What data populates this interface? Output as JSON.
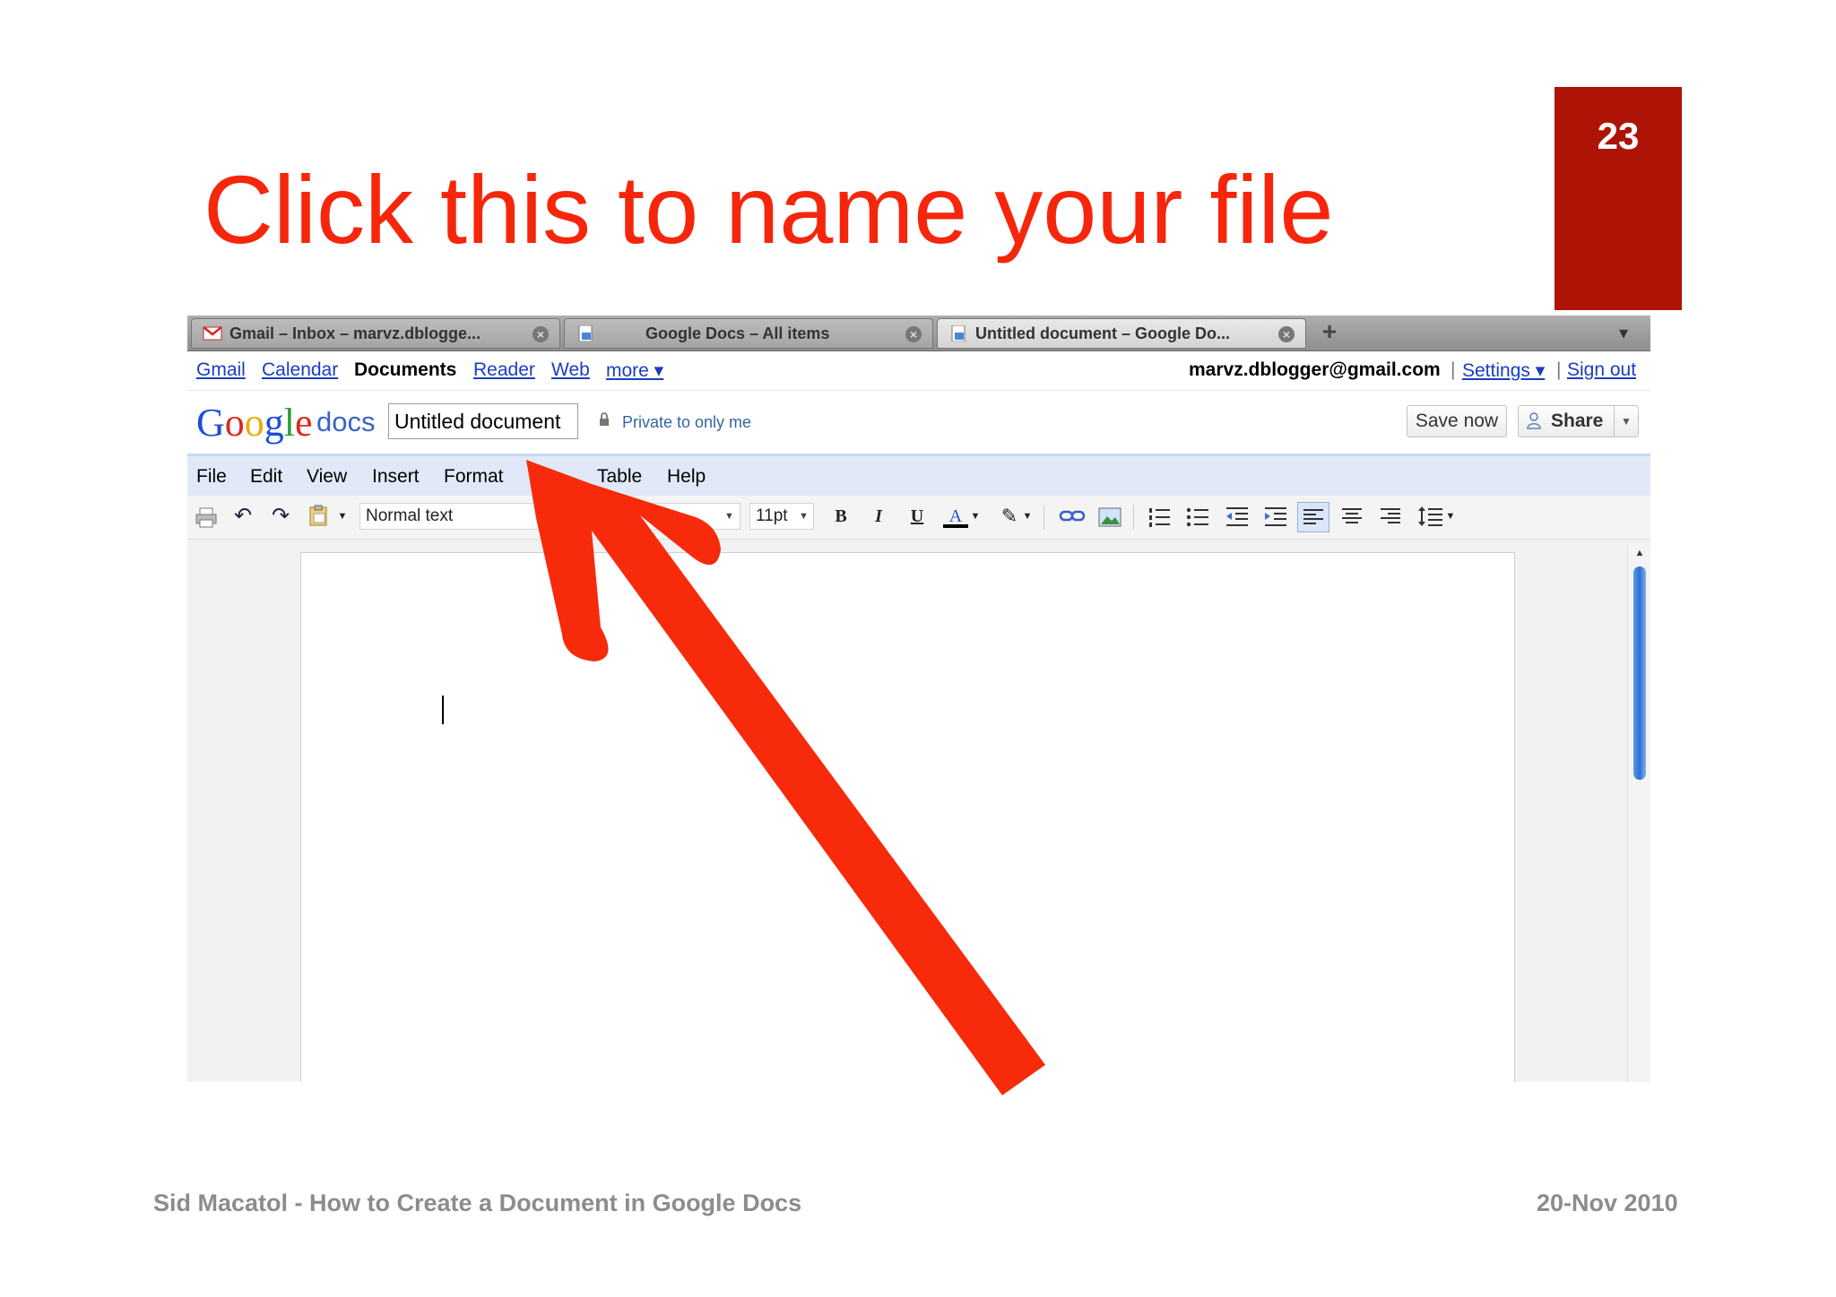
{
  "slide": {
    "number": "23",
    "title": "Click this to name your file",
    "footer_left": "Sid Macatol - How to Create a Document in Google Docs",
    "footer_right": "20-Nov 2010",
    "accent_color": "#f5260c",
    "number_box_color": "#ad1405"
  },
  "browser": {
    "tabs": [
      {
        "label": "Gmail – Inbox – marvz.dblogge...",
        "icon": "gmail-icon",
        "active": false
      },
      {
        "label": "Google Docs – All items",
        "icon": "docs-icon",
        "active": false
      },
      {
        "label": "Untitled document – Google Do...",
        "icon": "docs-icon",
        "active": true
      }
    ],
    "new_tab_label": "+"
  },
  "gbar": {
    "links": [
      "Gmail",
      "Calendar",
      "Documents",
      "Reader",
      "Web",
      "more ▾"
    ],
    "active": "Documents",
    "account_email": "marvz.dblogger@gmail.com",
    "settings_label": "Settings ▾",
    "signout_label": "Sign out",
    "separator": "|"
  },
  "doc": {
    "logo_text": "Google",
    "product_text": "docs",
    "title": "Untitled document",
    "privacy": "Private to only me",
    "save_label": "Save now",
    "share_label": "Share"
  },
  "menubar": {
    "items": [
      "File",
      "Edit",
      "View",
      "Insert",
      "Format",
      "Table",
      "Help"
    ]
  },
  "toolbar": {
    "style_value": "Normal text",
    "size_value": "11pt",
    "bold": "B",
    "italic": "I",
    "underline": "U",
    "text_color": "A"
  },
  "annotation": {
    "arrow_color": "#f72a0c"
  }
}
